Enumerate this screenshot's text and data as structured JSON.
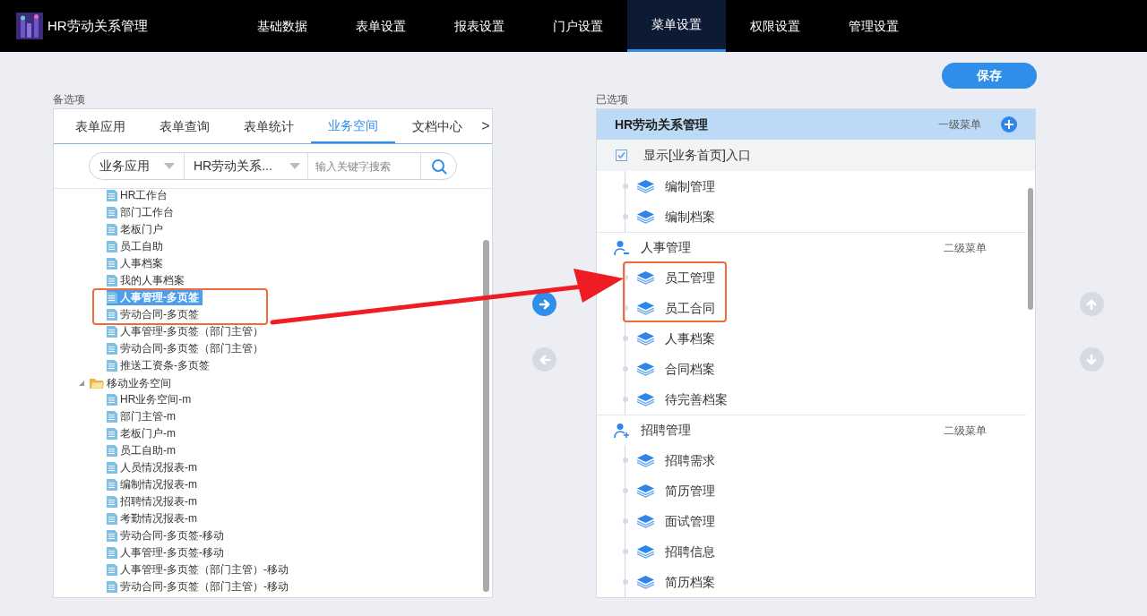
{
  "app": {
    "title": "HR劳动关系管理"
  },
  "nav": [
    {
      "label": "基础数据",
      "selected": false
    },
    {
      "label": "表单设置",
      "selected": false
    },
    {
      "label": "报表设置",
      "selected": false
    },
    {
      "label": "门户设置",
      "selected": false
    },
    {
      "label": "菜单设置",
      "selected": true
    },
    {
      "label": "权限设置",
      "selected": false
    },
    {
      "label": "管理设置",
      "selected": false
    }
  ],
  "save_button": "保存",
  "available": {
    "label": "备选项",
    "tabs": [
      {
        "label": "表单应用",
        "selected": false
      },
      {
        "label": "表单查询",
        "selected": false
      },
      {
        "label": "表单统计",
        "selected": false
      },
      {
        "label": "业务空间",
        "selected": true
      },
      {
        "label": "文档中心",
        "selected": false
      }
    ],
    "more_tabs": ">",
    "filter": {
      "category": "业务应用",
      "app": "HR劳动关系...",
      "placeholder": "输入关键字搜索"
    },
    "tree": [
      {
        "kind": "file",
        "label": "HR工作台",
        "selected": false
      },
      {
        "kind": "file",
        "label": "部门工作台",
        "selected": false
      },
      {
        "kind": "file",
        "label": "老板门户",
        "selected": false
      },
      {
        "kind": "file",
        "label": "员工自助",
        "selected": false
      },
      {
        "kind": "file",
        "label": "人事档案",
        "selected": false
      },
      {
        "kind": "file",
        "label": "我的人事档案",
        "selected": false
      },
      {
        "kind": "file",
        "label": "人事管理-多页签",
        "selected": true
      },
      {
        "kind": "file",
        "label": "劳动合同-多页签",
        "selected": false
      },
      {
        "kind": "file",
        "label": "人事管理-多页签（部门主管）",
        "selected": false
      },
      {
        "kind": "file",
        "label": "劳动合同-多页签（部门主管）",
        "selected": false
      },
      {
        "kind": "file",
        "label": "推送工资条-多页签",
        "selected": false
      },
      {
        "kind": "folder",
        "label": "移动业务空间",
        "selected": false,
        "expanded": true,
        "children": [
          {
            "kind": "file",
            "label": "HR业务空间-m",
            "selected": false
          },
          {
            "kind": "file",
            "label": "部门主管-m",
            "selected": false
          },
          {
            "kind": "file",
            "label": "老板门户-m",
            "selected": false
          },
          {
            "kind": "file",
            "label": "员工自助-m",
            "selected": false
          },
          {
            "kind": "file",
            "label": "人员情况报表-m",
            "selected": false
          },
          {
            "kind": "file",
            "label": "编制情况报表-m",
            "selected": false
          },
          {
            "kind": "file",
            "label": "招聘情况报表-m",
            "selected": false
          },
          {
            "kind": "file",
            "label": "考勤情况报表-m",
            "selected": false
          },
          {
            "kind": "file",
            "label": "劳动合同-多页签-移动",
            "selected": false
          },
          {
            "kind": "file",
            "label": "人事管理-多页签-移动",
            "selected": false
          },
          {
            "kind": "file",
            "label": " 人事管理-多页签（部门主管）-移动",
            "selected": false
          },
          {
            "kind": "file",
            "label": "劳动合同-多页签（部门主管）-移动",
            "selected": false
          }
        ]
      }
    ]
  },
  "transfer": [
    {
      "kind": "add",
      "disabled": false
    },
    {
      "kind": "remove",
      "disabled": true
    }
  ],
  "selected_panel": {
    "label": "已选项",
    "root": {
      "title": "HR劳动关系管理",
      "level": "一级菜单"
    },
    "show_home": {
      "label": "显示[业务首页]入口",
      "checked": true
    },
    "sections": [
      {
        "kind": "plain",
        "items": [
          {
            "label": "编制管理"
          },
          {
            "label": "编制档案"
          }
        ]
      },
      {
        "kind": "person",
        "title": "人事管理",
        "level": "二级菜单",
        "items": [
          {
            "label": "员工管理"
          },
          {
            "label": "员工合同"
          },
          {
            "label": "人事档案"
          },
          {
            "label": "合同档案"
          },
          {
            "label": "待完善档案"
          }
        ]
      },
      {
        "kind": "person-add",
        "title": "招聘管理",
        "level": "二级菜单",
        "items": [
          {
            "label": "招聘需求"
          },
          {
            "label": "简历管理"
          },
          {
            "label": "面试管理"
          },
          {
            "label": "招聘信息"
          },
          {
            "label": "简历档案"
          }
        ]
      }
    ]
  },
  "order": [
    {
      "kind": "up",
      "disabled": true
    },
    {
      "kind": "down",
      "disabled": true
    }
  ]
}
